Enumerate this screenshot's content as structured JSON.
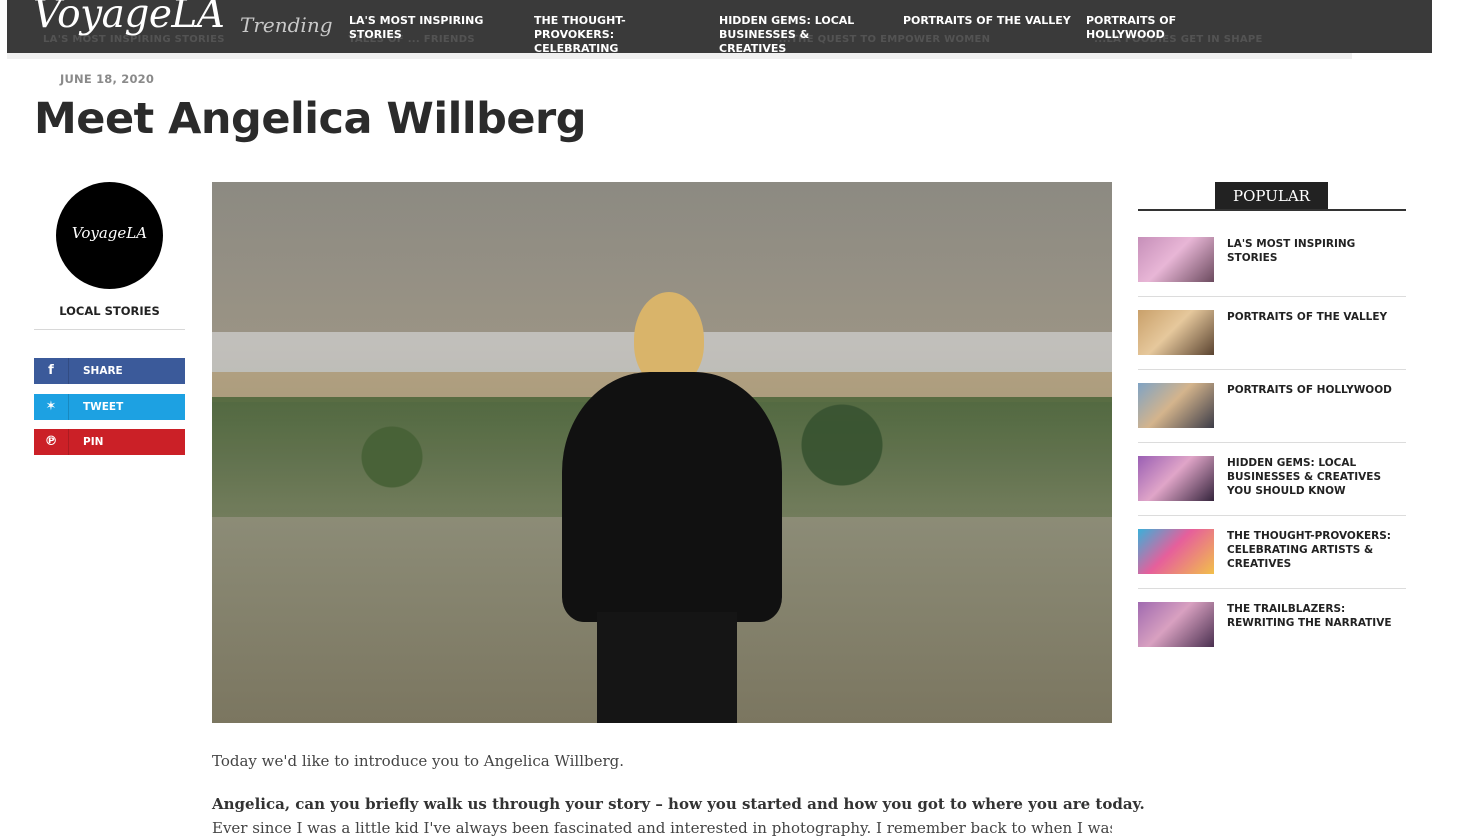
{
  "site": {
    "brand": "VoyageLA",
    "trending_label": "Trending"
  },
  "ticker": [
    "LA'S MOST INSPIRING STORIES",
    "TALES OF ... FRIENDS",
    "...THE QUEST TO EMPOWER WOMEN",
    "...LA FOODIES GET IN SHAPE"
  ],
  "nav": [
    "LA'S MOST INSPIRING STORIES",
    "THE THOUGHT-PROVOKERS: CELEBRATING",
    "HIDDEN GEMS: LOCAL BUSINESSES & CREATIVES",
    "PORTRAITS OF THE VALLEY",
    "PORTRAITS OF HOLLYWOOD"
  ],
  "article": {
    "date": "JUNE 18, 2020",
    "title": "Meet Angelica Willberg",
    "intro": "Today we'd like to introduce you to Angelica Willberg.",
    "question": "Angelica, can you briefly walk us through your story – how you started and how you got to where you are today.",
    "answer_start": "Ever since I was a little kid I've always been fascinated and interested in photography. I remember back to when I was around the"
  },
  "sidebar_left": {
    "logo_text": "VoyageLA",
    "category": "LOCAL STORIES",
    "share_buttons": [
      {
        "label": "SHARE",
        "icon": "facebook-icon",
        "glyph": "f",
        "color": "#3b5a9a"
      },
      {
        "label": "TWEET",
        "icon": "twitter-icon",
        "glyph": "✶",
        "color": "#1da1e2"
      },
      {
        "label": "PIN",
        "icon": "pinterest-icon",
        "glyph": "℗",
        "color": "#cb2027"
      }
    ]
  },
  "popular": {
    "heading": "POPULAR",
    "items": [
      {
        "title": "LA'S MOST INSPIRING STORIES",
        "colors": [
          "#c68fb9",
          "#e8b6d6",
          "#6b4a5e"
        ]
      },
      {
        "title": "PORTRAITS OF THE VALLEY",
        "colors": [
          "#c9a06a",
          "#e6c89c",
          "#5a4330"
        ]
      },
      {
        "title": "PORTRAITS OF HOLLYWOOD",
        "colors": [
          "#7fa3c4",
          "#d4b48c",
          "#3c3c48"
        ]
      },
      {
        "title": "HIDDEN GEMS: LOCAL BUSINESSES & CREATIVES YOU SHOULD KNOW",
        "colors": [
          "#9a5fb4",
          "#e0a5c8",
          "#34243c"
        ]
      },
      {
        "title": "THE THOUGHT-PROVOKERS: CELEBRATING ARTISTS & CREATIVES",
        "colors": [
          "#3ab0d9",
          "#e65f9b",
          "#f2c04a"
        ]
      },
      {
        "title": "THE TRAILBLAZERS: REWRITING THE NARRATIVE",
        "colors": [
          "#a06ab0",
          "#d8a0c0",
          "#4a3050"
        ]
      }
    ]
  }
}
